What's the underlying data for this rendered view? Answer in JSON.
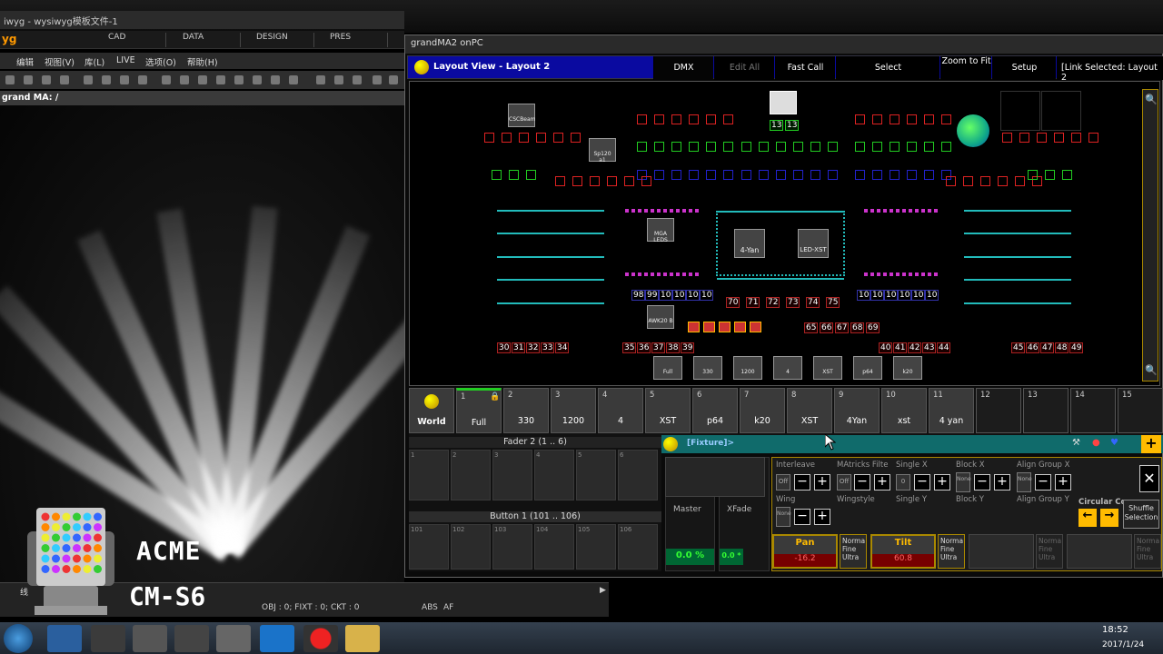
{
  "wysiwyg": {
    "title": "iwyg - wysiwyg模板文件-1",
    "logo": "yg",
    "modes": [
      "CAD",
      "DATA",
      "DESIGN",
      "PRES"
    ],
    "menu": [
      "编辑",
      "视图(V)",
      "库(L)",
      "LIVE",
      "选项(O)",
      "帮助(H)"
    ],
    "doc_title": "grand MA: /",
    "status_text": "OBJ : 0; FIXT : 0; CKT : 0",
    "status_abs": "ABS",
    "status_af": "AF",
    "status_left": "线"
  },
  "overlay": {
    "brand": "ACME",
    "model": "CM-S6"
  },
  "grandma": {
    "title": "grandMA2 onPC",
    "view_title": "Layout View - Layout 2",
    "header_buttons": [
      "DMX",
      "Edit All",
      "Fast Call",
      "Select",
      "Zoom to Fit",
      "Setup",
      "[Link Selected: Layout 2"
    ],
    "layout": {
      "top_fixture_nums": [
        "13",
        "13"
      ],
      "left_fixtures": [
        "CSCBeam",
        "Sp120 a1"
      ],
      "mid_fixtures": [
        "MGA LEDS",
        "AWK20 B"
      ],
      "center_fixtures": [
        "4-Yan",
        "LED-XST"
      ],
      "row_left": [
        "98",
        "99",
        "10",
        "10",
        "10",
        "10"
      ],
      "row_right": [
        "10",
        "10",
        "10",
        "10",
        "10",
        "10"
      ],
      "row_center": [
        "70",
        "71",
        "72",
        "73",
        "74",
        "75"
      ],
      "row_center2": [
        "65",
        "66",
        "67",
        "68",
        "69"
      ],
      "row_bottom_1": [
        "30",
        "31",
        "32",
        "33",
        "34"
      ],
      "row_bottom_2": [
        "35",
        "36",
        "37",
        "38",
        "39"
      ],
      "row_bottom_3": [
        "40",
        "41",
        "42",
        "43",
        "44"
      ],
      "row_bottom_4": [
        "45",
        "46",
        "47",
        "48",
        "49"
      ],
      "bottom_groups": [
        "Full",
        "330",
        "1200",
        "4",
        "XST",
        "p64",
        "k20"
      ]
    },
    "presets": {
      "world": "World",
      "items": [
        {
          "n": "1",
          "label": "Full"
        },
        {
          "n": "2",
          "label": "330"
        },
        {
          "n": "3",
          "label": "1200"
        },
        {
          "n": "4",
          "label": "4"
        },
        {
          "n": "5",
          "label": "XST"
        },
        {
          "n": "6",
          "label": "p64"
        },
        {
          "n": "7",
          "label": "k20"
        },
        {
          "n": "8",
          "label": "XST"
        },
        {
          "n": "9",
          "label": "4Yan"
        },
        {
          "n": "10",
          "label": "xst"
        },
        {
          "n": "11",
          "label": "4 yan"
        },
        {
          "n": "12",
          "label": ""
        },
        {
          "n": "13",
          "label": ""
        },
        {
          "n": "14",
          "label": ""
        },
        {
          "n": "15",
          "label": ""
        }
      ]
    },
    "fader_title": "Fader 2 (1 .. 6)",
    "fader_nums": [
      "1",
      "2",
      "3",
      "4",
      "5",
      "6"
    ],
    "button_title": "Button 1 (101 .. 106)",
    "button_nums": [
      "101",
      "102",
      "103",
      "104",
      "105",
      "106"
    ],
    "master": {
      "label": "Master",
      "value": "0.0 %"
    },
    "xfade": {
      "label": "XFade",
      "value": "0.0 *"
    },
    "fixture_sheet": "[Fixture]>",
    "encoders": {
      "labels_top": [
        "Interleave",
        "MAtricks Filte",
        "Single X",
        "Block X",
        "Align Group X"
      ],
      "labels_bot": [
        "Wing",
        "Wingstyle",
        "Single Y",
        "Block Y",
        "Align Group Y"
      ],
      "off": "Off",
      "none": "None",
      "zero": "0",
      "circular": "Circular Co",
      "shuffle": "Shuffle Selection",
      "pan": {
        "label": "Pan",
        "value": "-16.2"
      },
      "tilt": {
        "label": "Tilt",
        "value": "60.8"
      },
      "norm": "Norma",
      "fine": "Fine",
      "ultra": "Ultra"
    }
  },
  "taskbar": {
    "time": "18:52",
    "date": "2017/1/24"
  }
}
